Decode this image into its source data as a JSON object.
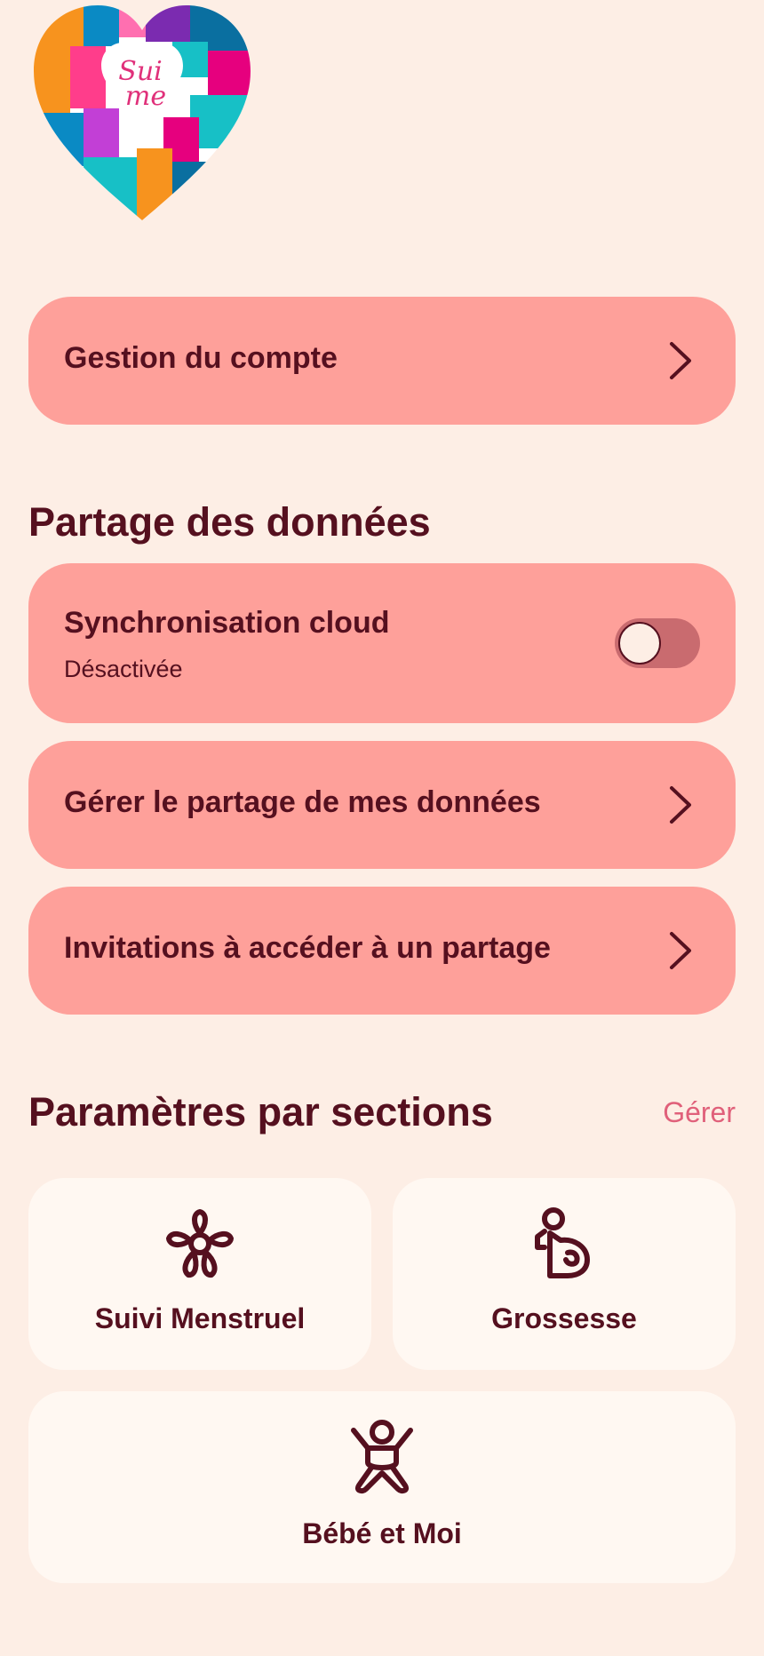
{
  "logo": {
    "text_line1": "Sui",
    "text_line2": "me"
  },
  "account": {
    "label": "Gestion du compte",
    "icon": "chevron-right-icon"
  },
  "data_sharing": {
    "title": "Partage des données",
    "cloud_sync": {
      "label": "Synchronisation cloud",
      "status": "Désactivée",
      "enabled": false
    },
    "manage_sharing": {
      "label": "Gérer le partage de mes données",
      "icon": "chevron-right-icon"
    },
    "invitations": {
      "label": "Invitations à accéder à un partage",
      "icon": "chevron-right-icon"
    }
  },
  "sections": {
    "title": "Paramètres par sections",
    "manage_label": "Gérer",
    "tiles": [
      {
        "label": "Suivi Menstruel",
        "icon": "flower-icon"
      },
      {
        "label": "Grossesse",
        "icon": "pregnancy-icon"
      },
      {
        "label": "Bébé et Moi",
        "icon": "baby-icon"
      }
    ]
  },
  "colors": {
    "background": "#fdeee5",
    "card": "#fea09a",
    "tile": "#fff8f2",
    "text": "#55101f",
    "accent": "#e0607a",
    "toggle_track": "#c96b6f"
  }
}
